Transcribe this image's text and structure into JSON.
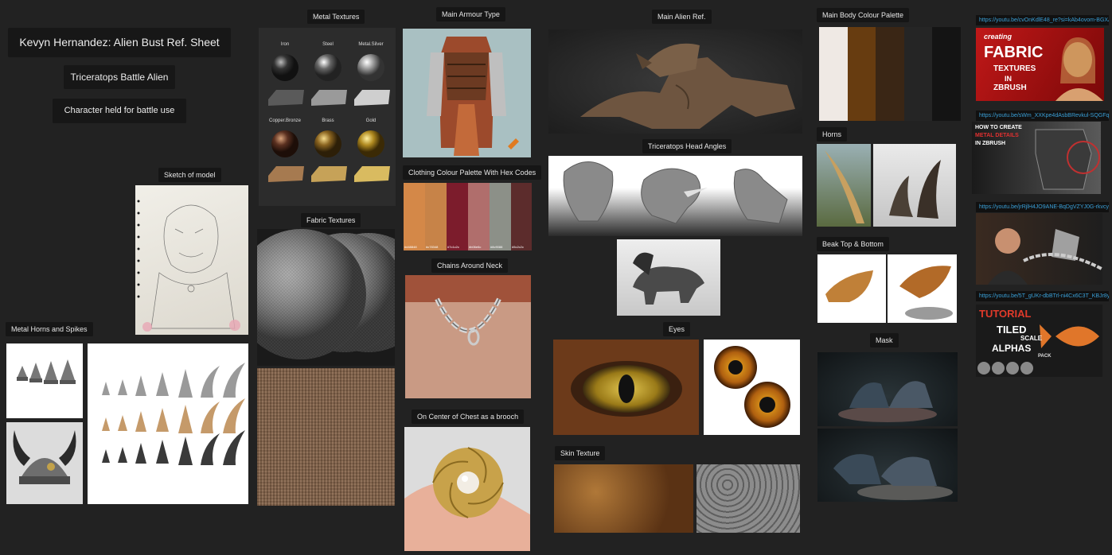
{
  "header": {
    "title": "Kevyn Hernandez: Alien Bust Ref. Sheet",
    "subtitle": "Triceratops Battle Alien",
    "note": "Character held for battle use"
  },
  "labels": {
    "sketch": "Sketch of model",
    "metal_horns": "Metal Horns and Spikes",
    "metal_textures": "Metal Textures",
    "fabric_textures": "Fabric Textures",
    "main_armour": "Main Armour Type",
    "clothing_palette": "Clothing Colour Palette With Hex Codes",
    "chains": "Chains Around Neck",
    "brooch": "On Center of Chest as a brooch",
    "main_alien": "Main Alien Ref.",
    "head_angles": "Triceratops Head Angles",
    "eyes": "Eyes",
    "skin": "Skin Texture",
    "body_palette": "Main Body Colour Palette",
    "horns": "Horns",
    "beak": "Beak Top & Bottom",
    "mask": "Mask"
  },
  "metal_spheres": [
    "Iron",
    "Steel",
    "Metal.Silver",
    "Copper.Bronze",
    "Brass",
    "Gold"
  ],
  "clothing_palette": [
    "#d48848",
    "#c78348",
    "#7c1c2c",
    "#b06e6c",
    "#8c9088",
    "#5c2c2c"
  ],
  "body_palette": [
    "#efe9e4",
    "#673c10",
    "#3a2615",
    "#252525",
    "#141414"
  ],
  "tutorials": {
    "t1_link": "https://youtu.be/cvOnKdlE48_re?si=kAb4ovom-BGXA9rr",
    "t1_line1": "creating",
    "t1_line2": "FABRIC",
    "t1_line3": "TEXTURES",
    "t1_line4": "IN",
    "t1_line5": "ZBRUSH",
    "t2_link": "https://youtu.be/sWm_XXKpe4dAsbBRevkul-SQGFqhG",
    "t2_line1": "HOW TO CREATE",
    "t2_line2": "METAL DETAILS",
    "t2_line3": "IN ZBRUSH",
    "t3_link": "https://youtu.be/jrRjlH4JO9ANE-BqDgVZYJ0G-rkvcyh",
    "t4_link": "https://youtu.be/5T_gUKr-dbBTrl-ni4Cx6C3T_KBJr8y",
    "t4_line1": "TUTORIAL",
    "t4_line2": "TILED",
    "t4_line3": "SCALE",
    "t4_line4": "ALPHAS",
    "t4_line5": "PACK"
  }
}
